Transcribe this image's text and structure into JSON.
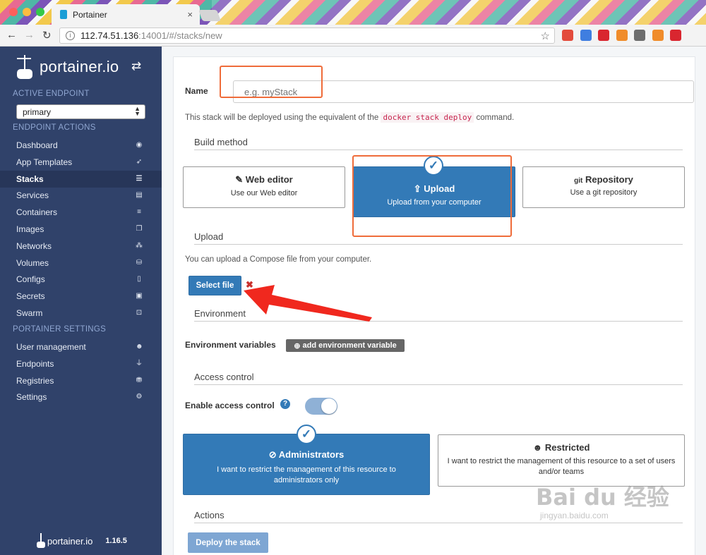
{
  "browser": {
    "tab_title": "Portainer",
    "tab_close": "×",
    "url_host": "112.74.51.136",
    "url_path": ":14001/#/stacks/new",
    "info_glyph": "i",
    "bookmark_glyph": "☆",
    "extension_colors": [
      "#e34b3c",
      "#3f7ee0",
      "#d9262f",
      "#f08c2a",
      "#6d6d6d",
      "#f08c2a",
      "#d9262f"
    ]
  },
  "sidebar": {
    "brand": "portainer.io",
    "toggle_icon": "⇄",
    "active_endpoint_title": "ACTIVE ENDPOINT",
    "endpoint_selected": "primary",
    "endpoint_actions_title": "ENDPOINT ACTIONS",
    "items": [
      {
        "label": "Dashboard",
        "icon": "◉"
      },
      {
        "label": "App Templates",
        "icon": "➶"
      },
      {
        "label": "Stacks",
        "icon": "☰",
        "active": true
      },
      {
        "label": "Services",
        "icon": "▤"
      },
      {
        "label": "Containers",
        "icon": "≡"
      },
      {
        "label": "Images",
        "icon": "❐"
      },
      {
        "label": "Networks",
        "icon": "⁂"
      },
      {
        "label": "Volumes",
        "icon": "⛁"
      },
      {
        "label": "Configs",
        "icon": "▯"
      },
      {
        "label": "Secrets",
        "icon": "▣"
      },
      {
        "label": "Swarm",
        "icon": "⊡"
      }
    ],
    "portainer_settings_title": "PORTAINER SETTINGS",
    "settings_items": [
      {
        "label": "User management",
        "icon": "☻"
      },
      {
        "label": "Endpoints",
        "icon": "⏚"
      },
      {
        "label": "Registries",
        "icon": "⛃"
      },
      {
        "label": "Settings",
        "icon": "⚙"
      }
    ],
    "footer_brand": "portainer.io",
    "version": "1.16.5"
  },
  "form": {
    "name_label": "Name",
    "name_placeholder": "e.g. myStack",
    "help_prefix": "This stack will be deployed using the equivalent of the",
    "help_code": "docker stack deploy",
    "help_suffix": "command.",
    "build_method_title": "Build method",
    "methods": [
      {
        "title": "Web editor",
        "description": "Use our Web editor",
        "icon": "✎"
      },
      {
        "title": "Upload",
        "description": "Upload from your computer",
        "icon": "⇪",
        "selected": true
      },
      {
        "title": "Repository",
        "description": "Use a git repository",
        "icon": "git"
      }
    ],
    "check_glyph": "✓",
    "upload_title": "Upload",
    "upload_help": "You can upload a Compose file from your computer.",
    "select_file_label": "Select file",
    "remove_glyph": "✖",
    "environment_title": "Environment",
    "env_vars_label": "Environment variables",
    "add_env_label": "add environment variable",
    "add_env_icon": "⊕",
    "access_control_title": "Access control",
    "enable_access_label": "Enable access control",
    "help_icon_glyph": "?",
    "access_enabled": true,
    "access_options": [
      {
        "title": "Administrators",
        "description": "I want to restrict the management of this resource to administrators only",
        "icon": "⊘",
        "selected": true
      },
      {
        "title": "Restricted",
        "description": "I want to restrict the management of this resource to a set of users and/or teams",
        "icon": "☻"
      }
    ],
    "actions_title": "Actions",
    "deploy_label": "Deploy the stack"
  },
  "annotation": {
    "highlight_color": "#ef6c3a",
    "arrow_color": "#f0281e"
  },
  "watermark": {
    "brand": "Bai du 经验",
    "url": "jingyan.baidu.com"
  }
}
